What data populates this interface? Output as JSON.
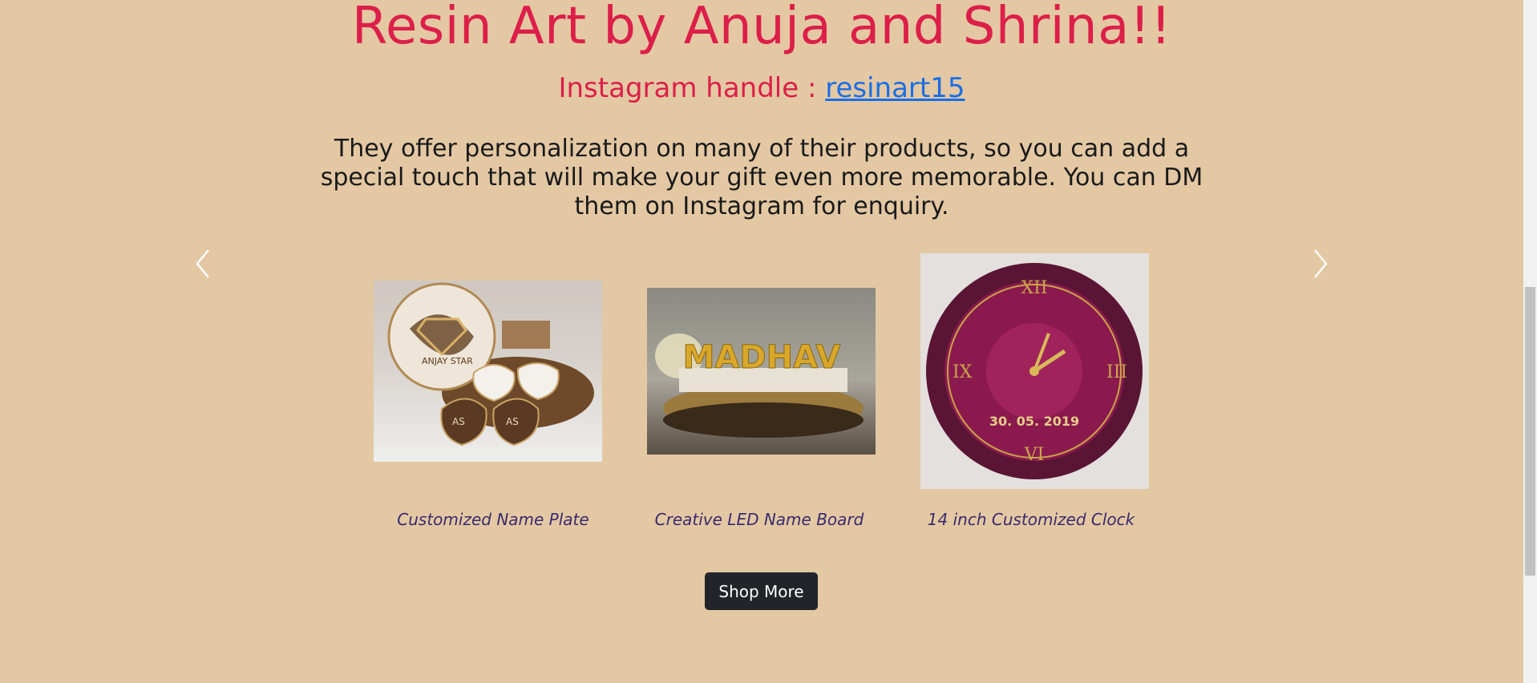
{
  "header": {
    "title": "Resin Art by Anuja and Shrina!!",
    "handle_label": "Instagram handle : ",
    "handle_link": "resinart15"
  },
  "description": "They offer personalization on many of their products, so you can add a special touch that will make your gift even more memorable. You can DM them on Instagram for enquiry.",
  "carousel": {
    "prev_icon": "chevron-left-icon",
    "next_icon": "chevron-right-icon",
    "items": [
      {
        "caption": "Customized Name Plate",
        "image": "name-plate-coasters"
      },
      {
        "caption": "Creative LED Name Board",
        "image": "led-name-board",
        "board_text": "MADHAV"
      },
      {
        "caption": "14 inch Customized Clock",
        "image": "resin-clock",
        "clock_text": "30. 05. 2019"
      }
    ]
  },
  "actions": {
    "shop_more_label": "Shop More"
  },
  "colors": {
    "background": "#e3c8a3",
    "title": "#dc1f49",
    "link": "#1a6ee6",
    "caption": "#3a2a6e",
    "button": "#212529"
  }
}
